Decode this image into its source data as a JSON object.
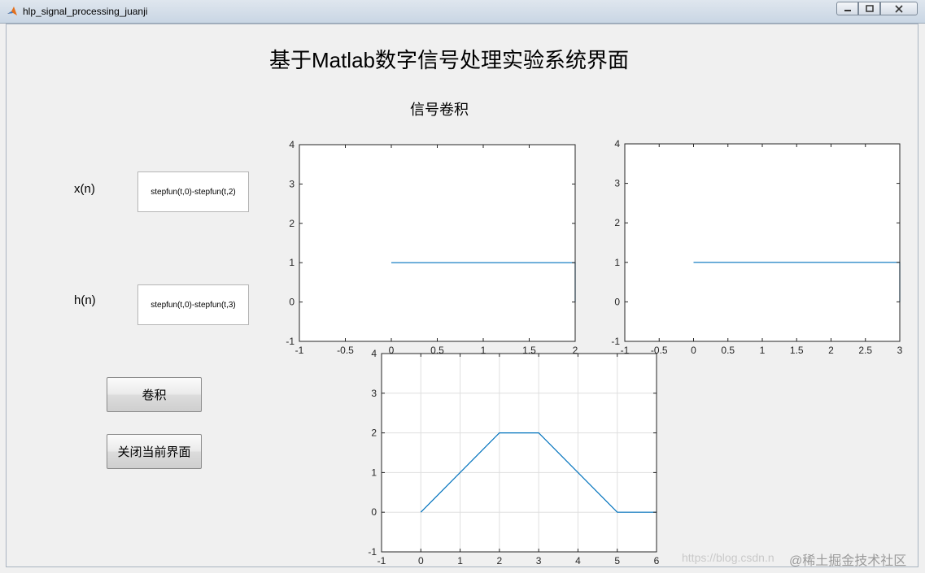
{
  "window": {
    "title": "hlp_signal_processing_juanji"
  },
  "header": {
    "title": "基于Matlab数字信号处理实验系统界面",
    "subtitle": "信号卷积"
  },
  "inputs": {
    "x_label": "x(n)",
    "x_value": "stepfun(t,0)-stepfun(t,2)",
    "h_label": "h(n)",
    "h_value": "stepfun(t,0)-stepfun(t,3)"
  },
  "buttons": {
    "convolve": "卷积",
    "close": "关闭当前界面"
  },
  "footer": {
    "watermark": "https://blog.csdn.n",
    "brand": "@稀土掘金技术社区"
  },
  "colors": {
    "line": "#0072bd",
    "grid": "#dfdfdf",
    "axis": "#262626"
  },
  "chart_data": [
    {
      "type": "line",
      "xlim": [
        -1,
        2
      ],
      "ylim": [
        -1,
        4
      ],
      "xticks": [
        "-1",
        "-0.5",
        "0",
        "0.5",
        "1",
        "1.5",
        "2"
      ],
      "yticks": [
        "-1",
        "0",
        "1",
        "2",
        "3",
        "4"
      ],
      "grid": false,
      "series": [
        {
          "x": [
            0,
            2,
            2
          ],
          "y": [
            1,
            1,
            0
          ]
        }
      ]
    },
    {
      "type": "line",
      "xlim": [
        -1,
        3
      ],
      "ylim": [
        -1,
        4
      ],
      "xticks": [
        "-1",
        "-0.5",
        "0",
        "0.5",
        "1",
        "1.5",
        "2",
        "2.5",
        "3"
      ],
      "yticks": [
        "-1",
        "0",
        "1",
        "2",
        "3",
        "4"
      ],
      "grid": false,
      "series": [
        {
          "x": [
            0,
            3,
            3
          ],
          "y": [
            1,
            1,
            0
          ]
        }
      ]
    },
    {
      "type": "line",
      "xlim": [
        -1,
        6
      ],
      "ylim": [
        -1,
        4
      ],
      "xticks": [
        "-1",
        "0",
        "1",
        "2",
        "3",
        "4",
        "5",
        "6"
      ],
      "yticks": [
        "-1",
        "0",
        "1",
        "2",
        "3",
        "4"
      ],
      "grid": true,
      "series": [
        {
          "x": [
            0,
            2,
            3,
            5,
            6
          ],
          "y": [
            0,
            2,
            2,
            0,
            0
          ]
        }
      ]
    }
  ]
}
